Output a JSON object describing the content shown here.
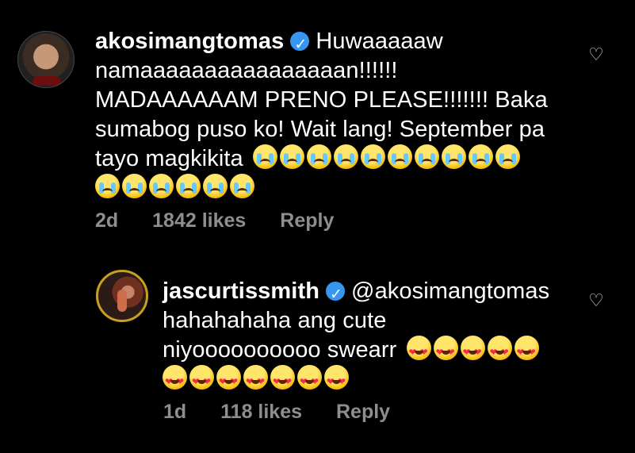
{
  "comments": {
    "main": {
      "username": "akosimangtomas",
      "line1_text": "Huwaaaaaw",
      "line2": "namaaaaaaaaaaaaaaaan!!!!!!",
      "line3": "MADAAAAAAM PRENO PLEASE!!!!!!! Baka",
      "line4": "sumabog puso ko! Wait lang! September pa",
      "line5_text": "tayo magkikita",
      "emoji_names": [
        "loudly-crying-face-icon"
      ],
      "time": "2d",
      "likes": "1842 likes",
      "reply": "Reply"
    },
    "reply": {
      "username": "jascurtissmith",
      "mention": "@akosimangtomas",
      "line2": "hahahahaha ang cute",
      "line3_text": "niyoooooooooo swearr",
      "emoji_names": [
        "smiling-face-with-heart-eyes-icon"
      ],
      "time": "1d",
      "likes": "118 likes",
      "reply": "Reply"
    }
  }
}
